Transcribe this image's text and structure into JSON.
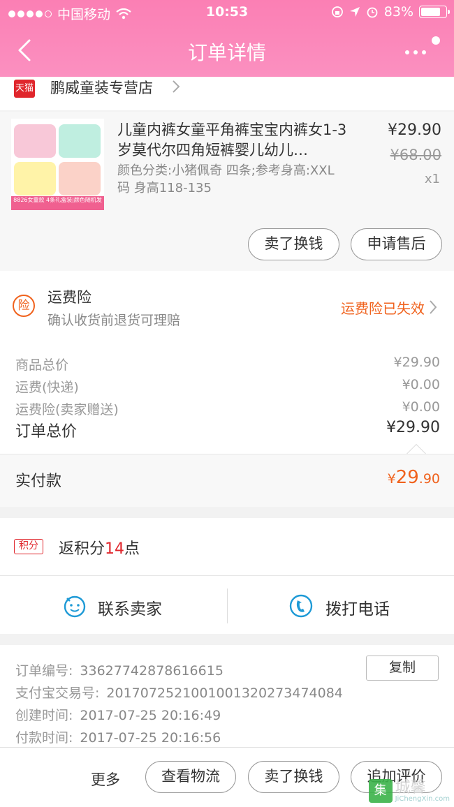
{
  "status_bar": {
    "carrier": "中国移动",
    "time": "10:53",
    "battery": "83%",
    "battery_level": 0.83
  },
  "header": {
    "title": "订单详情"
  },
  "store": {
    "badge": "天猫",
    "name": "鹏威童装专营店"
  },
  "product": {
    "title": "儿童内裤女童平角裤宝宝内裤女1-3岁莫代尔四角短裤婴儿幼儿…",
    "spec": "颜色分类:小猪佩奇 四条;参考身高:XXL码 身高118-135",
    "price": "¥29.90",
    "original_price": "¥68.00",
    "quantity": "x1",
    "image_banner": "8826女童款 4条礼盒装|颜色随机发",
    "buttons": {
      "resell": "卖了换钱",
      "after_sale": "申请售后"
    }
  },
  "insurance": {
    "icon_text": "险",
    "title": "运费险",
    "subtitle": "确认收货前退货可理赔",
    "status": "运费险已失效"
  },
  "summary": {
    "rows": [
      {
        "label": "商品总价",
        "value": "¥29.90"
      },
      {
        "label": "运费(快递)",
        "value": "¥0.00"
      },
      {
        "label": "运费险(卖家赠送)",
        "value": "¥0.00"
      }
    ],
    "total_label": "订单总价",
    "total_value": "¥29.90"
  },
  "paid": {
    "label": "实付款",
    "currency": "¥",
    "integer": "29",
    "decimal": ".90"
  },
  "points": {
    "badge": "积分",
    "prefix": "返积分",
    "count": "14",
    "suffix": "点"
  },
  "contact": {
    "seller": "联系卖家",
    "phone": "拨打电话"
  },
  "order_info": {
    "rows": [
      {
        "label": "订单编号:",
        "value": "33627742878616615"
      },
      {
        "label": "支付宝交易号:",
        "value": "2017072521001001320273474084"
      },
      {
        "label": "创建时间:",
        "value": "2017-07-25 20:16:49"
      },
      {
        "label": "付款时间:",
        "value": "2017-07-25 20:16:56"
      }
    ],
    "copy": "复制"
  },
  "bottom_bar": {
    "more": "更多",
    "logistics": "查看物流",
    "resell": "卖了换钱",
    "review": "追加评价"
  },
  "watermark": {
    "logo": "集",
    "cn": "城馨",
    "en": "JiChengXin.com"
  },
  "colors": {
    "header": "#fb7fb4",
    "accent_orange": "#f0621d",
    "tmall_red": "#e0262c",
    "icon_blue": "#1e9ad6"
  }
}
